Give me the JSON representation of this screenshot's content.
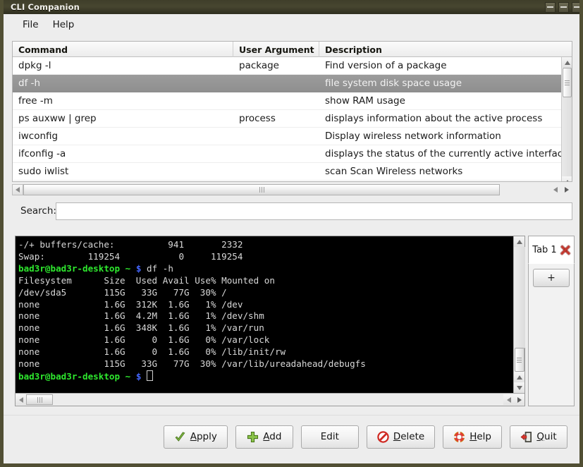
{
  "window": {
    "title": "CLI Companion",
    "buttons": [
      "minimize",
      "maximize",
      "close"
    ]
  },
  "menubar": {
    "items": [
      {
        "label": "File",
        "name": "menu-file"
      },
      {
        "label": "Help",
        "name": "menu-help"
      }
    ]
  },
  "table": {
    "columns": [
      "Command",
      "User Argument",
      "Description"
    ],
    "selected_index": 1,
    "rows": [
      {
        "command": "dpkg -l",
        "argument": "package",
        "description": "Find version of a package"
      },
      {
        "command": "df -h",
        "argument": "",
        "description": "file system disk space usage"
      },
      {
        "command": "free -m",
        "argument": "",
        "description": "show RAM usage"
      },
      {
        "command": "ps auxww | grep",
        "argument": "process",
        "description": "displays information about the active process"
      },
      {
        "command": "iwconfig",
        "argument": "",
        "description": "Display wireless network information"
      },
      {
        "command": "ifconfig -a",
        "argument": "",
        "description": "displays the status of the currently active interfaces"
      },
      {
        "command": "sudo iwlist",
        "argument": "",
        "description": "scan Scan Wireless networks"
      }
    ]
  },
  "search": {
    "label": "Search:",
    "value": "",
    "placeholder": ""
  },
  "terminal": {
    "prompt_user": "bad3r@bad3r-desktop",
    "prompt_path": "~",
    "prompt_symbol": "$",
    "lines": [
      {
        "type": "out",
        "text": "-/+ buffers/cache:          941       2332"
      },
      {
        "type": "out",
        "text": "Swap:        119254           0     119254"
      },
      {
        "type": "prompt",
        "command": "df -h"
      },
      {
        "type": "out",
        "text": "Filesystem      Size  Used Avail Use% Mounted on"
      },
      {
        "type": "out",
        "text": "/dev/sda5       115G   33G   77G  30% /"
      },
      {
        "type": "out",
        "text": "none            1.6G  312K  1.6G   1% /dev"
      },
      {
        "type": "out",
        "text": "none            1.6G  4.2M  1.6G   1% /dev/shm"
      },
      {
        "type": "out",
        "text": "none            1.6G  348K  1.6G   1% /var/run"
      },
      {
        "type": "out",
        "text": "none            1.6G     0  1.6G   0% /var/lock"
      },
      {
        "type": "out",
        "text": "none            1.6G     0  1.6G   0% /lib/init/rw"
      },
      {
        "type": "out",
        "text": "none            115G   33G   77G  30% /var/lib/ureadahead/debugfs"
      },
      {
        "type": "prompt_cursor",
        "command": ""
      }
    ]
  },
  "tabs": {
    "items": [
      {
        "label": "Tab 1",
        "close_icon": "close-x-icon"
      }
    ],
    "add_label": "+"
  },
  "buttons": [
    {
      "name": "apply-button",
      "label": "Apply",
      "mnemonic": "A",
      "icon": "check-icon"
    },
    {
      "name": "add-button",
      "label": "Add",
      "mnemonic": "A",
      "icon": "plus-icon"
    },
    {
      "name": "edit-button",
      "label": "Edit",
      "mnemonic": "",
      "icon": ""
    },
    {
      "name": "delete-button",
      "label": "Delete",
      "mnemonic": "D",
      "icon": "no-entry-icon"
    },
    {
      "name": "help-button",
      "label": "Help",
      "mnemonic": "H",
      "icon": "lifebuoy-icon"
    },
    {
      "name": "quit-button",
      "label": "Quit",
      "mnemonic": "Q",
      "icon": "exit-door-icon"
    }
  ],
  "colors": {
    "titlebar": "#3f3e2a",
    "window_border": "#514f34",
    "selection": "#9c9c9c",
    "terminal_bg": "#000000",
    "terminal_fg": "#d8d8d8",
    "prompt_green": "#2ee82e",
    "prompt_blue": "#4466ff",
    "accent_red": "#c4392f",
    "accent_green": "#78b32a"
  }
}
